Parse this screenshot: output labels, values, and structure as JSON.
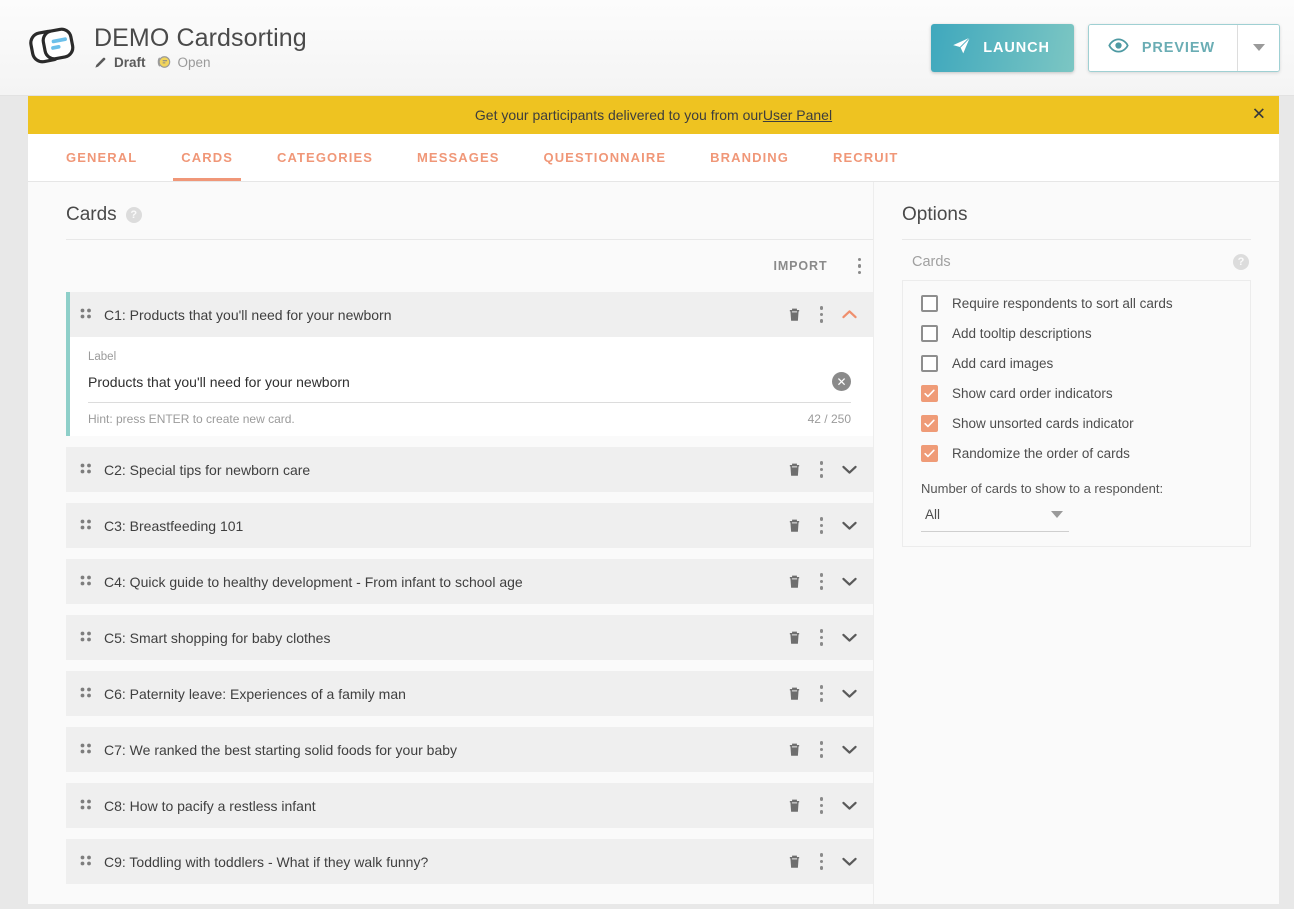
{
  "header": {
    "logo_icon": "cardsorting-logo-icon",
    "project_title": "DEMO Cardsorting",
    "status_draft": "Draft",
    "status_open": "Open",
    "launch_label": "LAUNCH",
    "preview_label": "PREVIEW",
    "accent_teal": "#3fa8bd",
    "accent_coral": "#ef8f6d"
  },
  "notice": {
    "text": "Get your participants delivered to you from our ",
    "link": "User Panel",
    "close_icon": "close-icon",
    "bg": "#eec321"
  },
  "tabs": [
    {
      "label": "GENERAL",
      "active": false
    },
    {
      "label": "CARDS",
      "active": true
    },
    {
      "label": "CATEGORIES",
      "active": false
    },
    {
      "label": "MESSAGES",
      "active": false
    },
    {
      "label": "QUESTIONNAIRE",
      "active": false
    },
    {
      "label": "BRANDING",
      "active": false
    },
    {
      "label": "RECRUIT",
      "active": false
    }
  ],
  "cards_panel": {
    "title": "Cards",
    "help_glyph": "?",
    "import_label": "IMPORT",
    "expanded_card": {
      "row_title": "C1: Products that you'll need for your newborn",
      "field_label": "Label",
      "field_value": "Products that you'll need for your newborn",
      "hint": "Hint: press ENTER to create new card.",
      "counter": "42 / 250"
    },
    "items": [
      {
        "title": "C2: Special tips for newborn care"
      },
      {
        "title": "C3: Breastfeeding 101"
      },
      {
        "title": "C4: Quick guide to healthy development - From infant to school age"
      },
      {
        "title": "C5: Smart shopping for baby clothes"
      },
      {
        "title": "C6: Paternity leave: Experiences of a family man"
      },
      {
        "title": "C7: We ranked the best starting solid foods for your baby"
      },
      {
        "title": "C8: How to pacify a restless infant"
      },
      {
        "title": "C9: Toddling with toddlers - What if they walk funny?"
      }
    ]
  },
  "options_panel": {
    "title": "Options",
    "subtitle": "Cards",
    "help_glyph": "?",
    "checkboxes": [
      {
        "label": "Require respondents to sort all cards",
        "checked": false
      },
      {
        "label": "Add tooltip descriptions",
        "checked": false
      },
      {
        "label": "Add card images",
        "checked": false
      },
      {
        "label": "Show card order indicators",
        "checked": true
      },
      {
        "label": "Show unsorted cards indicator",
        "checked": true
      },
      {
        "label": "Randomize the order of cards",
        "checked": true
      }
    ],
    "select_label": "Number of cards to show to a respondent:",
    "select_value": "All"
  }
}
